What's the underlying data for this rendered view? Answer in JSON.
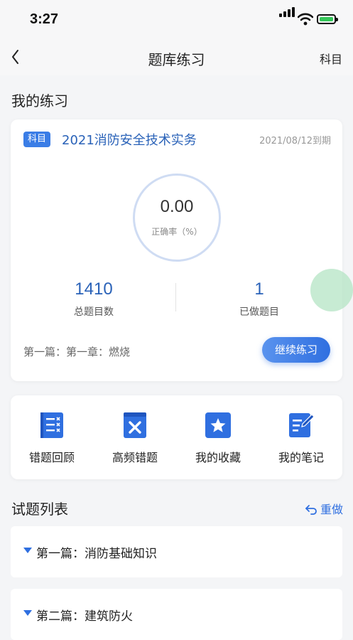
{
  "status": {
    "time": "3:27"
  },
  "nav": {
    "title": "题库练习",
    "right_label": "科目"
  },
  "my_practice": {
    "heading": "我的练习",
    "tag": "科目",
    "course": "2021消防安全技术实务",
    "expire": "2021/08/12到期",
    "accuracy_value": "0.00",
    "accuracy_label": "正确率（%）",
    "total_value": "1410",
    "total_label": "总题目数",
    "done_value": "1",
    "done_label": "已做题目",
    "chapter": "第一篇：第一章：燃烧",
    "continue_label": "继续练习"
  },
  "tools": [
    {
      "label": "错题回顾",
      "icon": "wrong-review-icon"
    },
    {
      "label": "高频错题",
      "icon": "frequent-errors-icon"
    },
    {
      "label": "我的收藏",
      "icon": "favorites-star-icon"
    },
    {
      "label": "我的笔记",
      "icon": "notes-edit-icon"
    }
  ],
  "question_list": {
    "heading": "试题列表",
    "redo_label": "重做",
    "items": [
      {
        "label": "第一篇：消防基础知识"
      },
      {
        "label": "第二篇：建筑防火"
      }
    ]
  },
  "colors": {
    "accent": "#2f6fe0",
    "primary_text": "#2a62b8",
    "float_button": "#b4e4c4"
  }
}
